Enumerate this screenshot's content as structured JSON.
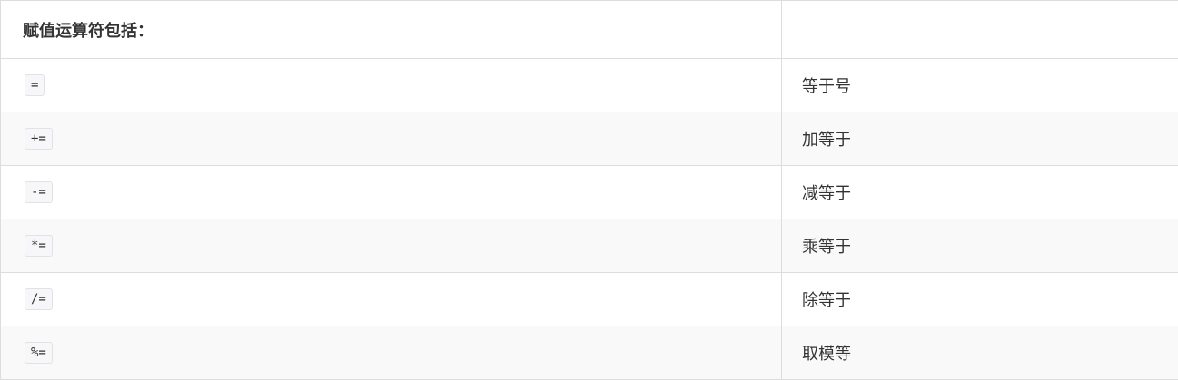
{
  "table": {
    "header": {
      "col1": "赋值运算符包括：",
      "col2": ""
    },
    "rows": [
      {
        "operator": "=",
        "description": "等于号"
      },
      {
        "operator": "+=",
        "description": "加等于"
      },
      {
        "operator": "-=",
        "description": "减等于"
      },
      {
        "operator": "*=",
        "description": "乘等于"
      },
      {
        "operator": "/=",
        "description": "除等于"
      },
      {
        "operator": "%=",
        "description": "取模等"
      }
    ]
  },
  "colors": {
    "border": "#dddddd",
    "stripe": "#f9f9f9",
    "code_bg": "#f7f7f9",
    "code_border": "#e1e1e8",
    "text": "#333333"
  }
}
